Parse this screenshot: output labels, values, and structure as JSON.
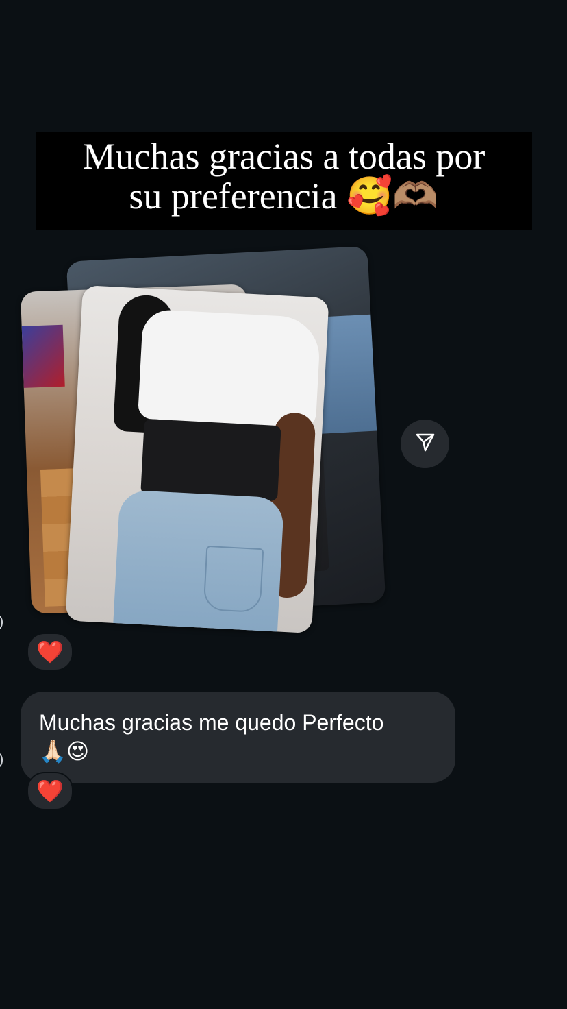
{
  "story": {
    "line1": "Muchas gracias a todas por",
    "line2": "su preferencia",
    "emoji": "🥰🫶🏽"
  },
  "photos": {
    "count": 3
  },
  "share": {
    "icon": "paper-plane-icon"
  },
  "reactions": [
    {
      "emoji": "❤️"
    },
    {
      "emoji": "❤️"
    }
  ],
  "message": {
    "text": "Muchas gracias me quedo Perfecto",
    "emoji": "🙏🏻😍"
  },
  "colors": {
    "background": "#0b1014",
    "bubble": "#262a2f",
    "banner": "#000000",
    "heart": "#e8323c"
  }
}
